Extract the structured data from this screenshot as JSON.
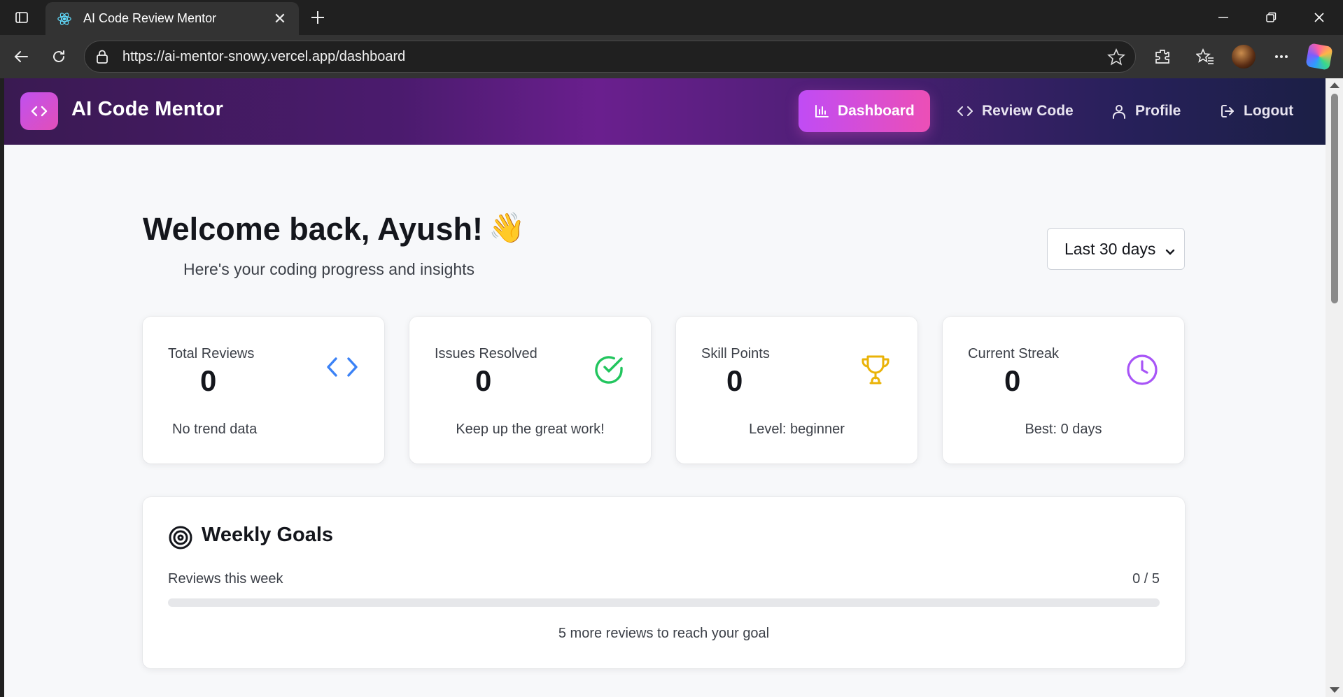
{
  "browser": {
    "tab_title": "AI Code Review Mentor",
    "url": "https://ai-mentor-snowy.vercel.app/dashboard"
  },
  "header": {
    "brand": "AI Code Mentor",
    "nav": {
      "dashboard": "Dashboard",
      "review": "Review Code",
      "profile": "Profile",
      "logout": "Logout"
    }
  },
  "welcome": {
    "title": "Welcome back, Ayush!",
    "emoji": "👋",
    "subtitle": "Here's your coding progress and insights"
  },
  "range_select": {
    "selected": "Last 30 days"
  },
  "stats": [
    {
      "label": "Total Reviews",
      "value": "0",
      "footer": "No trend data",
      "icon": "code-icon",
      "color": "#3b82f6"
    },
    {
      "label": "Issues Resolved",
      "value": "0",
      "footer": "Keep up the great work!",
      "icon": "check-circle-icon",
      "color": "#22c55e"
    },
    {
      "label": "Skill Points",
      "value": "0",
      "footer": "Level: beginner",
      "icon": "trophy-icon",
      "color": "#eab308"
    },
    {
      "label": "Current Streak",
      "value": "0",
      "footer": "Best: 0 days",
      "icon": "clock-icon",
      "color": "#a855f7"
    }
  ],
  "weekly_goals": {
    "title": "Weekly Goals",
    "label": "Reviews this week",
    "count": "0 / 5",
    "progress": 0,
    "note": "5 more reviews to reach your goal"
  }
}
